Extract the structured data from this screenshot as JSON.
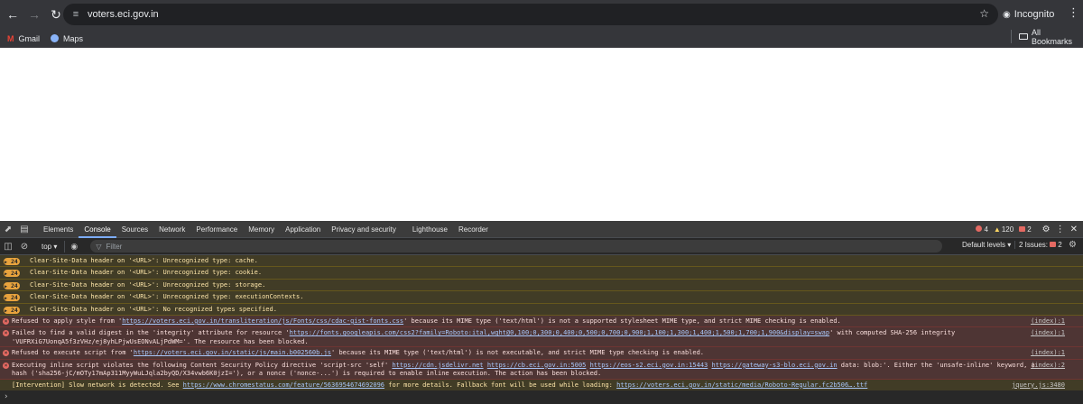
{
  "browser": {
    "url": "voters.eci.gov.in",
    "incognito_label": "Incognito",
    "bookmarks": [
      {
        "label": "Gmail",
        "icon": "gmail-icon"
      },
      {
        "label": "Maps",
        "icon": "maps-icon"
      }
    ],
    "all_bookmarks_label": "All Bookmarks"
  },
  "devtools": {
    "tabs": [
      "Elements",
      "Console",
      "Sources",
      "Network",
      "Performance",
      "Memory",
      "Application",
      "Privacy and security",
      "Lighthouse",
      "Recorder"
    ],
    "active_tab": "Console",
    "error_count": "4",
    "warning_count": "120",
    "issue_count": "2",
    "context": "top",
    "filter_placeholder": "Filter",
    "levels_label": "Default levels",
    "issues_label": "2 Issues:",
    "issues_badge": "2"
  },
  "console": {
    "warnings": [
      {
        "count": "24",
        "text": "Clear-Site-Data header on '<URL>': Unrecognized type: cache."
      },
      {
        "count": "24",
        "text": "Clear-Site-Data header on '<URL>': Unrecognized type: cookie."
      },
      {
        "count": "24",
        "text": "Clear-Site-Data header on '<URL>': Unrecognized type: storage."
      },
      {
        "count": "24",
        "text": "Clear-Site-Data header on '<URL>': Unrecognized type: executionContexts."
      },
      {
        "count": "24",
        "text": "Clear-Site-Data header on '<URL>': No recognized types specified."
      }
    ],
    "error1": {
      "pre": "Refused to apply style from '",
      "link": "https://voters.eci.gov.in/transliteration/js/Fonts/css/cdac-gist-fonts.css",
      "post": "' because its MIME type ('text/html') is not a supported stylesheet MIME type, and strict MIME checking is enabled.",
      "source": "(index):1"
    },
    "error2": {
      "pre": "Failed to find a valid digest in the 'integrity' attribute for resource '",
      "link": "https://fonts.googleapis.com/css2?family=Roboto:ital,wght@0,100;0,300;0,400;0,500;0,700;0,900;1,100;1,300;1,400;1,500;1,700;1,900&display=swap",
      "post": "' with computed SHA-256 integrity",
      "line2": "'VUFRXiG7UonqA5f3zVHz/ej8yhLPjwUsEONvALjPdWM='. The resource has been blocked.",
      "source": "(index):1"
    },
    "error3": {
      "pre": "Refused to execute script from '",
      "link": "https://voters.eci.gov.in/static/js/main.b002560b.js",
      "post": "' because its MIME type ('text/html') is not executable, and strict MIME type checking is enabled.",
      "source": "(index):1"
    },
    "error4": {
      "pre": "Executing inline script violates the following Content Security Policy directive 'script-src 'self' ",
      "link1": "https://cdn.jsdelivr.net",
      "link2": "https://cb.eci.gov.in:5005",
      "link3": "https://eos-s2.eci.gov.in:15443",
      "link4": "https://gateway-s3-blo.eci.gov.in",
      "post": " data: blob:'. Either the 'unsafe-inline' keyword, a",
      "line2": "hash ('sha256-jC/mOTy17mAp311MyyWuLJqla2byQD/X34vwb6K0jzI='), or a nonce ('nonce-...') is required to enable inline execution. The action has been blocked.",
      "source": "(index):2"
    },
    "intervention": {
      "pre": "[Intervention] Slow network is detected. See ",
      "link1": "https://www.chromestatus.com/feature/5636954674692096",
      "mid": " for more details. Fallback font will be used while loading: ",
      "link2": "https://voters.eci.gov.in/static/media/Roboto-Regular.fc2b506….ttf",
      "source": "jquery.js:3480"
    }
  }
}
